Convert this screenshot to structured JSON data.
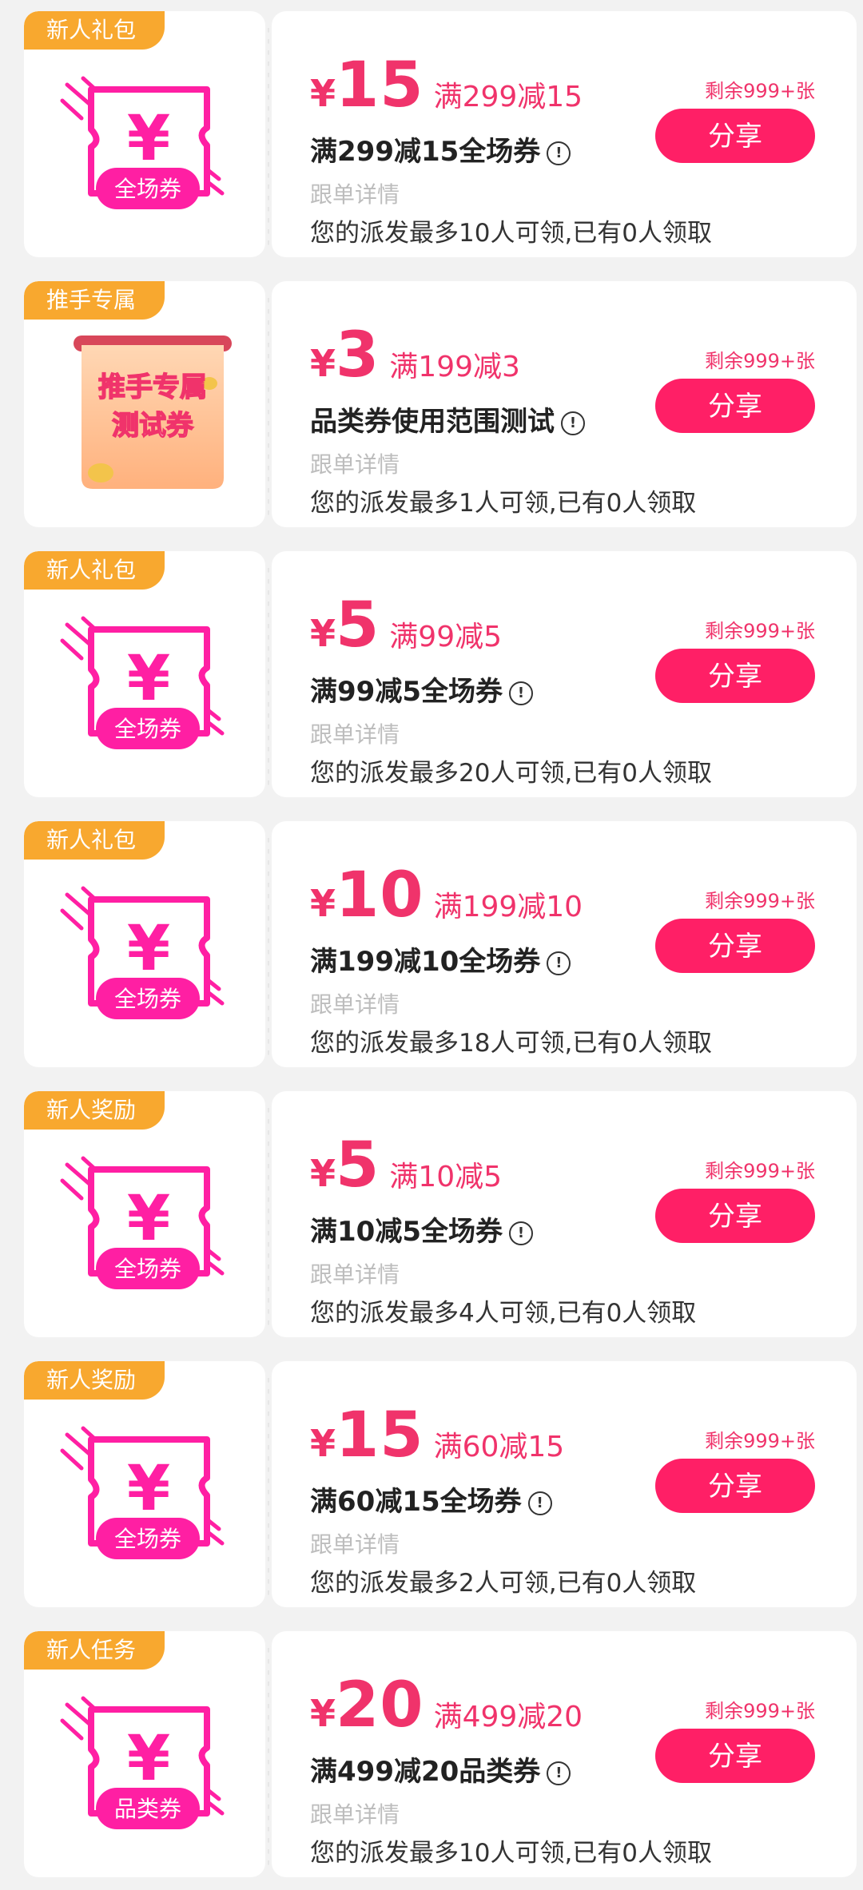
{
  "colors": {
    "accent": "#f0336b",
    "share_bg": "#ff1f66",
    "tag_bg": "#f8a82f",
    "icon_pink": "#ff1fa3"
  },
  "coupons": [
    {
      "tag": "新人礼包",
      "icon_label": "全场券",
      "currency": "¥",
      "value": "15",
      "condition": "满299减15",
      "name": "满299减15全场券",
      "detail": "跟单详情",
      "limit": "您的派发最多10人可领,已有0人领取",
      "remaining": "剩余999+张",
      "share": "分享"
    },
    {
      "tag": "推手专属",
      "icon_label": "推手专属测试券",
      "icon_line1": "推手专属",
      "icon_line2": "测试券",
      "currency": "¥",
      "value": "3",
      "condition": "满199减3",
      "name": "品类券使用范围测试",
      "detail": "跟单详情",
      "limit": "您的派发最多1人可领,已有0人领取",
      "remaining": "剩余999+张",
      "share": "分享"
    },
    {
      "tag": "新人礼包",
      "icon_label": "全场券",
      "currency": "¥",
      "value": "5",
      "condition": "满99减5",
      "name": "满99减5全场券",
      "detail": "跟单详情",
      "limit": "您的派发最多20人可领,已有0人领取",
      "remaining": "剩余999+张",
      "share": "分享"
    },
    {
      "tag": "新人礼包",
      "icon_label": "全场券",
      "currency": "¥",
      "value": "10",
      "condition": "满199减10",
      "name": "满199减10全场券",
      "detail": "跟单详情",
      "limit": "您的派发最多18人可领,已有0人领取",
      "remaining": "剩余999+张",
      "share": "分享"
    },
    {
      "tag": "新人奖励",
      "icon_label": "全场券",
      "currency": "¥",
      "value": "5",
      "condition": "满10减5",
      "name": "满10减5全场券",
      "detail": "跟单详情",
      "limit": "您的派发最多4人可领,已有0人领取",
      "remaining": "剩余999+张",
      "share": "分享"
    },
    {
      "tag": "新人奖励",
      "icon_label": "全场券",
      "currency": "¥",
      "value": "15",
      "condition": "满60减15",
      "name": "满60减15全场券",
      "detail": "跟单详情",
      "limit": "您的派发最多2人可领,已有0人领取",
      "remaining": "剩余999+张",
      "share": "分享"
    },
    {
      "tag": "新人任务",
      "icon_label": "品类券",
      "currency": "¥",
      "value": "20",
      "condition": "满499减20",
      "name": "满499减20品类券",
      "detail": "跟单详情",
      "limit": "您的派发最多10人可领,已有0人领取",
      "remaining": "剩余999+张",
      "share": "分享"
    }
  ]
}
